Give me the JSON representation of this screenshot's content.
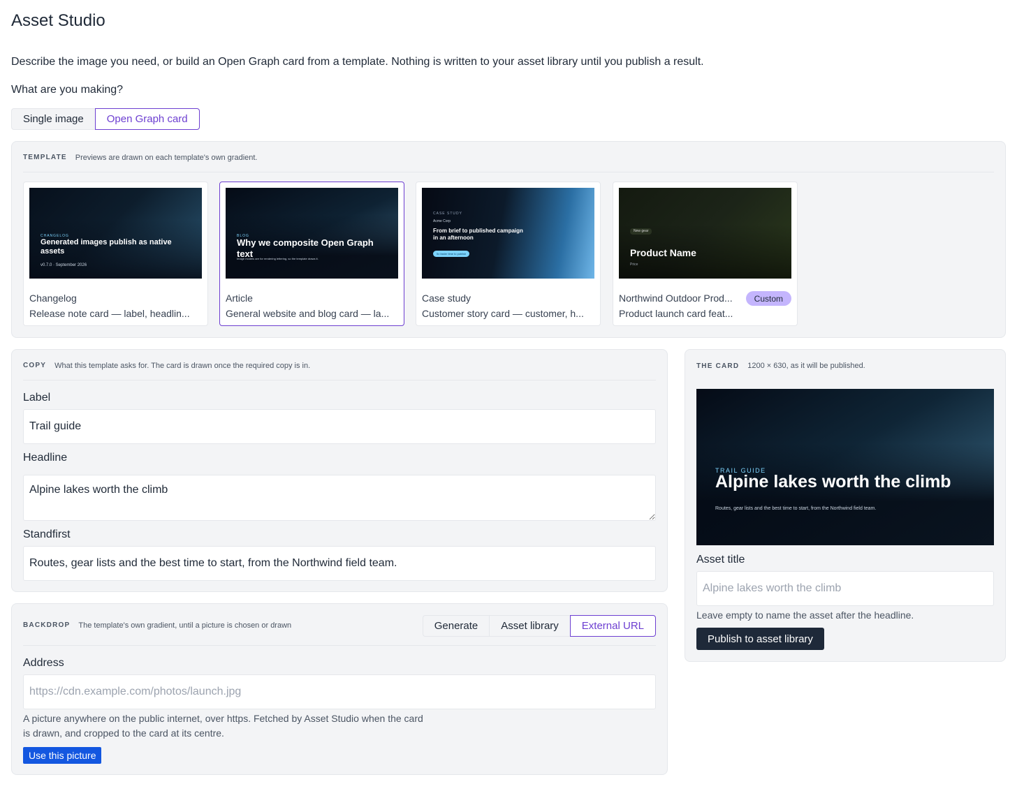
{
  "app": {
    "title": "Asset Studio",
    "intro": "Describe the image you need, or build an Open Graph card from a template. Nothing is written to your asset library until you publish a result.",
    "question": "What are you making?"
  },
  "mode": {
    "options": [
      "Single image",
      "Open Graph card"
    ],
    "selected": "Open Graph card"
  },
  "template": {
    "tag": "TEMPLATE",
    "desc": "Previews are drawn on each template's own gradient.",
    "cards": [
      {
        "name": "Changelog",
        "desc": "Release note card — label, headlin...",
        "selected": false,
        "preview": {
          "label": "CHANGELOG",
          "headline": "Generated images publish as native assets",
          "meta": "v0.7.0 · September 2026"
        }
      },
      {
        "name": "Article",
        "desc": "General website and blog card — la...",
        "selected": true,
        "preview": {
          "label": "BLOG",
          "headline": "Why we composite Open Graph text",
          "sub": "Image models are for rendering lettering, so the template draws it."
        }
      },
      {
        "name": "Case study",
        "desc": "Customer story card — customer, h...",
        "selected": false,
        "preview": {
          "label": "CASE STUDY",
          "customer": "Acme Corp",
          "headline": "From brief to published campaign in an afternoon",
          "pill": "5x faster time to publish"
        }
      },
      {
        "name": "Northwind Outdoor Prod...",
        "desc": "Product launch card feat...",
        "badge": "Custom",
        "selected": false,
        "preview": {
          "pill": "New gear",
          "headline": "Product Name",
          "price": "Price"
        }
      }
    ]
  },
  "copy": {
    "tag": "COPY",
    "desc": "What this template asks for. The card is drawn once the required copy is in.",
    "label": {
      "label": "Label",
      "value": "Trail guide"
    },
    "headline": {
      "label": "Headline",
      "value": "Alpine lakes worth the climb"
    },
    "standfirst": {
      "label": "Standfirst",
      "value": "Routes, gear lists and the best time to start, from the Northwind field team."
    }
  },
  "backdrop": {
    "tag": "BACKDROP",
    "desc": "The template's own gradient, until a picture is chosen or drawn",
    "tabs": [
      "Generate",
      "Asset library",
      "External URL"
    ],
    "selected_tab": "External URL",
    "address_label": "Address",
    "address_placeholder": "https://cdn.example.com/photos/launch.jpg",
    "help": "A picture anywhere on the public internet, over https. Fetched by Asset Studio when the card is drawn, and cropped to the card at its centre.",
    "button": "Use this picture"
  },
  "card": {
    "tag": "THE CARD",
    "desc": "1200 × 630, as it will be published.",
    "preview": {
      "label": "TRAIL GUIDE",
      "headline": "Alpine lakes worth the climb",
      "standfirst": "Routes, gear lists and the best time to start, from the Northwind field team."
    },
    "asset_title_label": "Asset title",
    "asset_title_placeholder": "Alpine lakes worth the climb",
    "asset_title_help": "Leave empty to name the asset after the headline.",
    "publish_button": "Publish to asset library"
  },
  "colors": {
    "accent": "#6d3fd1",
    "primary_blue": "#1357e0",
    "dark_button": "#1e2939",
    "badge": "#c4b5fd"
  }
}
